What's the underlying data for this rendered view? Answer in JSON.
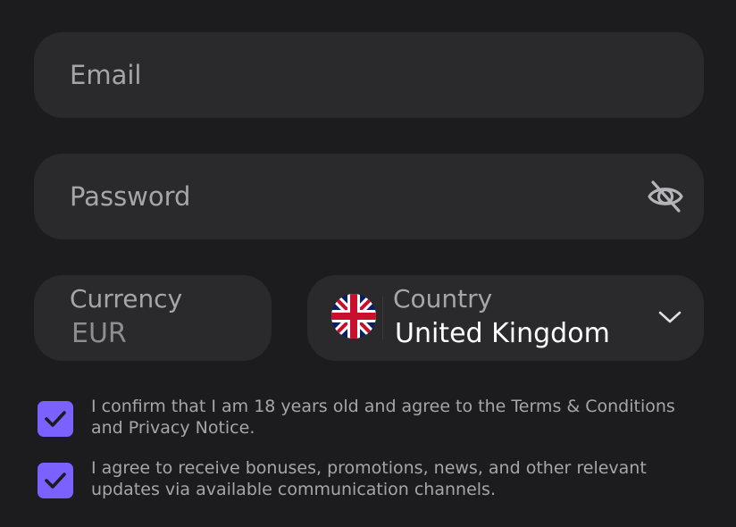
{
  "email": {
    "placeholder": "Email"
  },
  "password": {
    "placeholder": "Password",
    "toggle_icon": "eye-off-icon"
  },
  "currency": {
    "label": "Currency",
    "value": "EUR"
  },
  "country": {
    "label": "Country",
    "value": "United Kingdom",
    "flag_icon": "uk-flag-icon"
  },
  "consents": [
    {
      "checked": true,
      "text": "I confirm that I am 18 years old and agree to the Terms & Conditions and Privacy Notice."
    },
    {
      "checked": true,
      "text": "I agree to receive bonuses, promotions, news, and other relevant updates via available communication channels."
    }
  ],
  "colors": {
    "background": "#1c1c1e",
    "field": "#2a2a2c",
    "accent": "#7b61ff",
    "muted_text": "#a6a6aa",
    "value_text": "#ffffff"
  }
}
